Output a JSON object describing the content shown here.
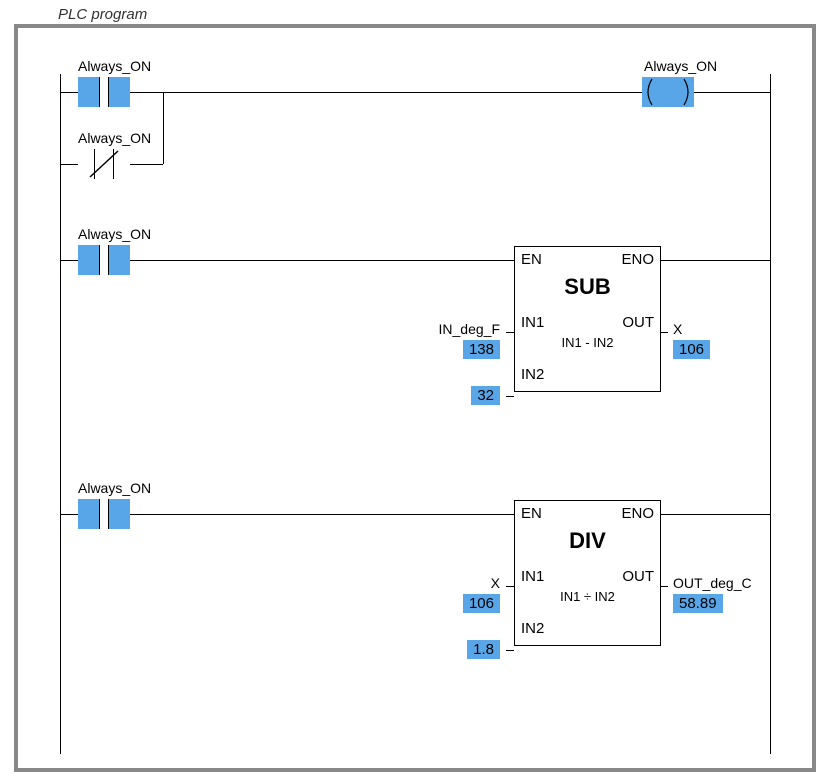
{
  "title": "PLC program",
  "rung1": {
    "contact1_label": "Always_ON",
    "contact2_label": "Always_ON",
    "coil_label": "Always_ON"
  },
  "rung2": {
    "contact_label": "Always_ON",
    "block": {
      "name": "SUB",
      "en": "EN",
      "eno": "ENO",
      "in1": "IN1",
      "in2": "IN2",
      "out": "OUT",
      "expr": "IN1 - IN2",
      "in1_tag": "IN_deg_F",
      "in1_val": "138",
      "in2_val": "32",
      "out_tag": "X",
      "out_val": "106"
    }
  },
  "rung3": {
    "contact_label": "Always_ON",
    "block": {
      "name": "DIV",
      "en": "EN",
      "eno": "ENO",
      "in1": "IN1",
      "in2": "IN2",
      "out": "OUT",
      "expr": "IN1 ÷ IN2",
      "in1_tag": "X",
      "in1_val": "106",
      "in2_val": "1.8",
      "out_tag": "OUT_deg_C",
      "out_val": "58.89"
    }
  }
}
